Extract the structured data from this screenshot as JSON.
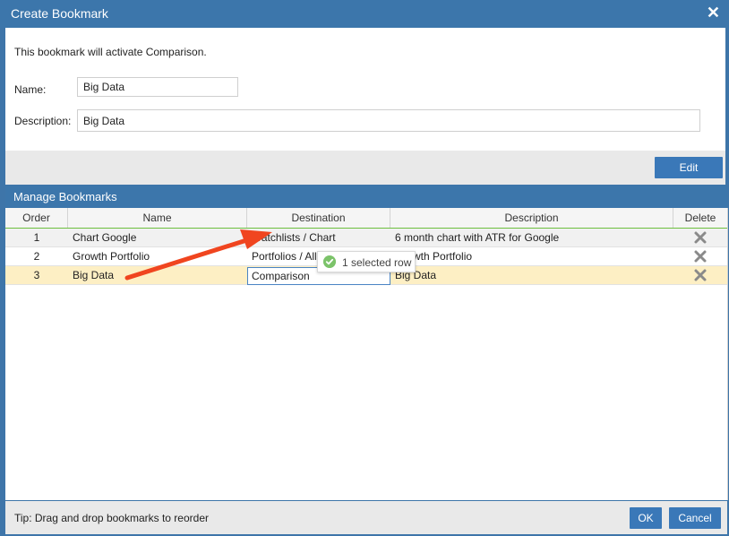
{
  "dialog": {
    "title": "Create Bookmark",
    "close_icon": "close-icon",
    "info": "This bookmark will activate Comparison.",
    "name_label": "Name:",
    "name_value": "Big Data",
    "description_label": "Description:",
    "description_value": "Big Data",
    "edit_label": "Edit"
  },
  "manage": {
    "title": "Manage Bookmarks",
    "columns": [
      "Order",
      "Name",
      "Destination",
      "Description",
      "Delete"
    ],
    "rows": [
      {
        "order": "1",
        "name": "Chart Google",
        "destination": "Watchlists / Chart",
        "description": "6 month chart with ATR for Google"
      },
      {
        "order": "2",
        "name": "Growth Portfolio",
        "destination": "Portfolios / All",
        "description": "Growth Portfolio"
      },
      {
        "order": "3",
        "name": "Big Data",
        "destination": "Comparison",
        "description": "Big Data"
      }
    ],
    "selected_row": 3,
    "tooltip": "1 selected row",
    "delete_icon": "delete-x-icon"
  },
  "footer": {
    "tip": "Tip: Drag and drop bookmarks to reorder",
    "ok_label": "OK",
    "cancel_label": "Cancel"
  },
  "colors": {
    "header_blue": "#3c76ab",
    "button_blue": "#3a78b8",
    "selected_row": "#fdefc4",
    "drop_indicator": "#6cbf3f",
    "annotation_arrow": "#f0451f"
  }
}
